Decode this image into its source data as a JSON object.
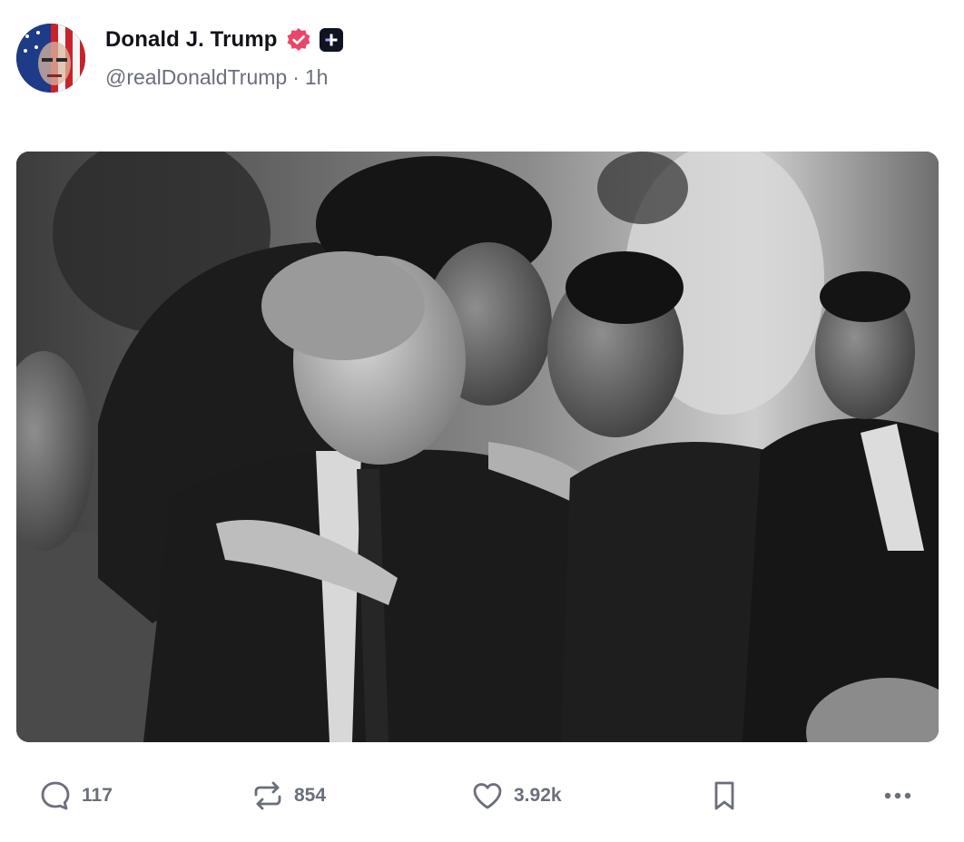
{
  "author": {
    "display_name": "Donald J. Trump",
    "handle": "@realDonaldTrump",
    "separator": "·",
    "time_ago": "1h",
    "verified_icon": "verified-badge-icon",
    "verified_color": "#e8476a",
    "plus_badge_icon": "plus-badge-icon"
  },
  "media": {
    "kind": "photo",
    "style": "black-and-white"
  },
  "actions": {
    "reply_count": "117",
    "repost_count": "854",
    "like_count": "3.92k",
    "reply_icon": "comment-bubble-icon",
    "repost_icon": "repost-arrows-icon",
    "like_icon": "heart-icon",
    "bookmark_icon": "bookmark-icon",
    "more_icon": "ellipsis-icon"
  },
  "colors": {
    "text": "#121218",
    "muted": "#6b6f7b",
    "badge_bg": "#111320"
  }
}
